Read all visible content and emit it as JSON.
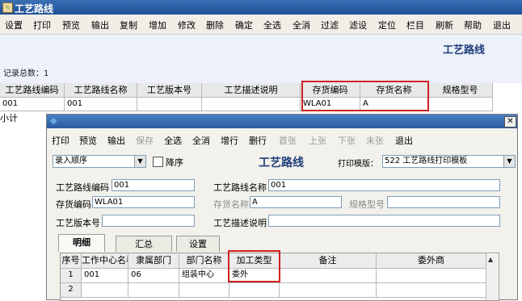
{
  "outer": {
    "title": "工艺路线",
    "toolbar": [
      "设置",
      "打印",
      "预览",
      "输出",
      "复制",
      "增加",
      "修改",
      "删除",
      "确定",
      "全选",
      "全消",
      "过滤",
      "滤设",
      "定位",
      "栏目",
      "刷新",
      "帮助",
      "退出"
    ],
    "heading": "工艺路线",
    "record_count": "记录总数：1",
    "columns": [
      "工艺路线编码",
      "工艺路线名称",
      "工艺版本号",
      "工艺描述说明",
      "存货编码",
      "存货名称",
      "规格型号"
    ],
    "row": [
      "001",
      "001",
      "",
      "",
      "WLA01",
      "A",
      ""
    ],
    "subtotal": "小计"
  },
  "dialog": {
    "toolbar": [
      {
        "label": "打印",
        "enabled": true
      },
      {
        "label": "预览",
        "enabled": true
      },
      {
        "label": "输出",
        "enabled": true
      },
      {
        "label": "保存",
        "enabled": false
      },
      {
        "label": "全选",
        "enabled": true
      },
      {
        "label": "全消",
        "enabled": true
      },
      {
        "label": "增行",
        "enabled": true
      },
      {
        "label": "删行",
        "enabled": true
      },
      {
        "label": "首张",
        "enabled": false
      },
      {
        "label": "上张",
        "enabled": false
      },
      {
        "label": "下张",
        "enabled": false
      },
      {
        "label": "末张",
        "enabled": false
      },
      {
        "label": "退出",
        "enabled": true
      }
    ],
    "order_select": "录入顺序",
    "desc_checkbox_label": "降序",
    "heading": "工艺路线",
    "print_template_label": "打印模版：",
    "print_template_value": "522 工艺路线打印模板",
    "fields": {
      "route_code_label": "工艺路线编码",
      "route_code": "001",
      "route_name_label": "工艺路线名称",
      "route_name": "001",
      "inv_code_label": "存货编码",
      "inv_code": "WLA01",
      "inv_name_label": "存货名称",
      "inv_name": "A",
      "spec_label": "规格型号",
      "spec": "",
      "version_label": "工艺版本号",
      "version": "",
      "desc_label": "工艺描述说明",
      "desc": ""
    },
    "tabs": [
      "明细",
      "汇总",
      "设置"
    ],
    "grid_columns": [
      "序号",
      "工作中心名称",
      "隶属部门",
      "部门名称",
      "加工类型",
      "备注",
      "委外商"
    ],
    "grid_rows": [
      [
        "1",
        "001",
        "06",
        "组装中心",
        "委外",
        "",
        ""
      ],
      [
        "2",
        "",
        "",
        "",
        "",
        "",
        ""
      ]
    ]
  }
}
